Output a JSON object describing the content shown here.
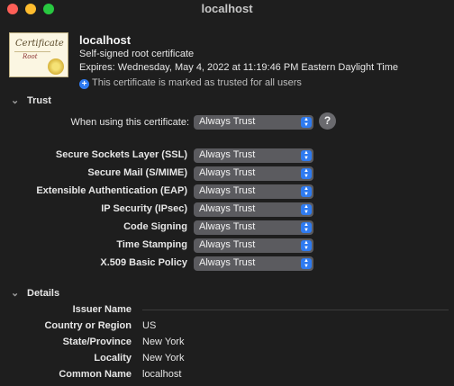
{
  "window": {
    "title": "localhost"
  },
  "header": {
    "name": "localhost",
    "type": "Self-signed root certificate",
    "expires": "Expires: Wednesday, May 4, 2022 at 11:19:46 PM Eastern Daylight Time",
    "trusted_note": "This certificate is marked as trusted for all users"
  },
  "icon_text": {
    "word": "Certificate",
    "sub": "Root"
  },
  "trust": {
    "section_label": "Trust",
    "when_using_label": "When using this certificate:",
    "when_using_value": "Always Trust",
    "help_label": "?",
    "rows": [
      {
        "label": "Secure Sockets Layer (SSL)",
        "value": "Always Trust"
      },
      {
        "label": "Secure Mail (S/MIME)",
        "value": "Always Trust"
      },
      {
        "label": "Extensible Authentication (EAP)",
        "value": "Always Trust"
      },
      {
        "label": "IP Security (IPsec)",
        "value": "Always Trust"
      },
      {
        "label": "Code Signing",
        "value": "Always Trust"
      },
      {
        "label": "Time Stamping",
        "value": "Always Trust"
      },
      {
        "label": "X.509 Basic Policy",
        "value": "Always Trust"
      }
    ]
  },
  "details": {
    "section_label": "Details",
    "rows": [
      {
        "label": "Issuer Name",
        "value": ""
      },
      {
        "label": "Country or Region",
        "value": "US"
      },
      {
        "label": "State/Province",
        "value": "New York"
      },
      {
        "label": "Locality",
        "value": "New York"
      },
      {
        "label": "Common Name",
        "value": "localhost"
      }
    ]
  },
  "icons": {
    "close": "close-dot",
    "minimize": "minimize-dot",
    "zoom": "zoom-dot",
    "certificate": "certificate-icon",
    "plus": "plus-circle-icon",
    "chevron": "chevron-down-icon",
    "select_arrows": "up-down-arrows-icon"
  },
  "colors": {
    "accent": "#2f7bf0",
    "background": "#1e1e1e",
    "popup": "#5b5b5f"
  }
}
